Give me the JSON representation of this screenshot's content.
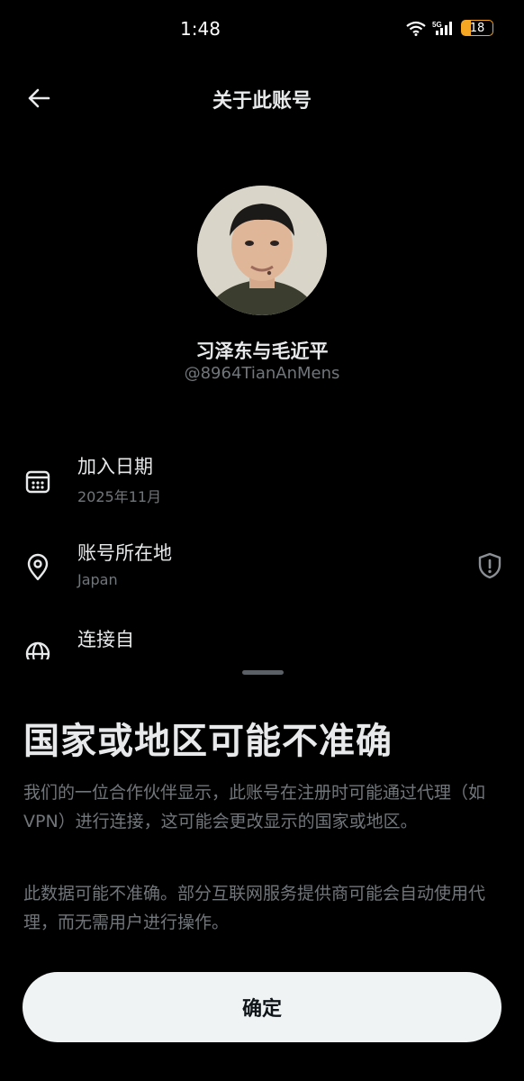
{
  "status_bar": {
    "time": "1:48",
    "battery": "18"
  },
  "header": {
    "title": "关于此账号"
  },
  "profile": {
    "display_name": "习泽东与毛近平",
    "handle": "@8964TianAnMens"
  },
  "info": [
    {
      "label": "加入日期",
      "value": "2025年11月",
      "icon": "calendar-icon"
    },
    {
      "label": "账号所在地",
      "value": "Japan",
      "icon": "location-pin-icon"
    },
    {
      "label": "连接自",
      "value": "",
      "icon": "globe-icon"
    }
  ],
  "sheet": {
    "title": "国家或地区可能不准确",
    "paragraph1": "我们的一位合作伙伴显示，此账号在注册时可能通过代理（如 VPN）进行连接，这可能会更改显示的国家或地区。",
    "paragraph2": "此数据可能不准确。部分互联网服务提供商可能会自动使用代理，而无需用户进行操作。",
    "confirm_label": "确定"
  },
  "colors": {
    "background": "#000000",
    "primary_text": "#e7e9ea",
    "secondary_text": "#71767b",
    "button_bg": "#eff3f4",
    "battery_accent": "#f5a623"
  }
}
